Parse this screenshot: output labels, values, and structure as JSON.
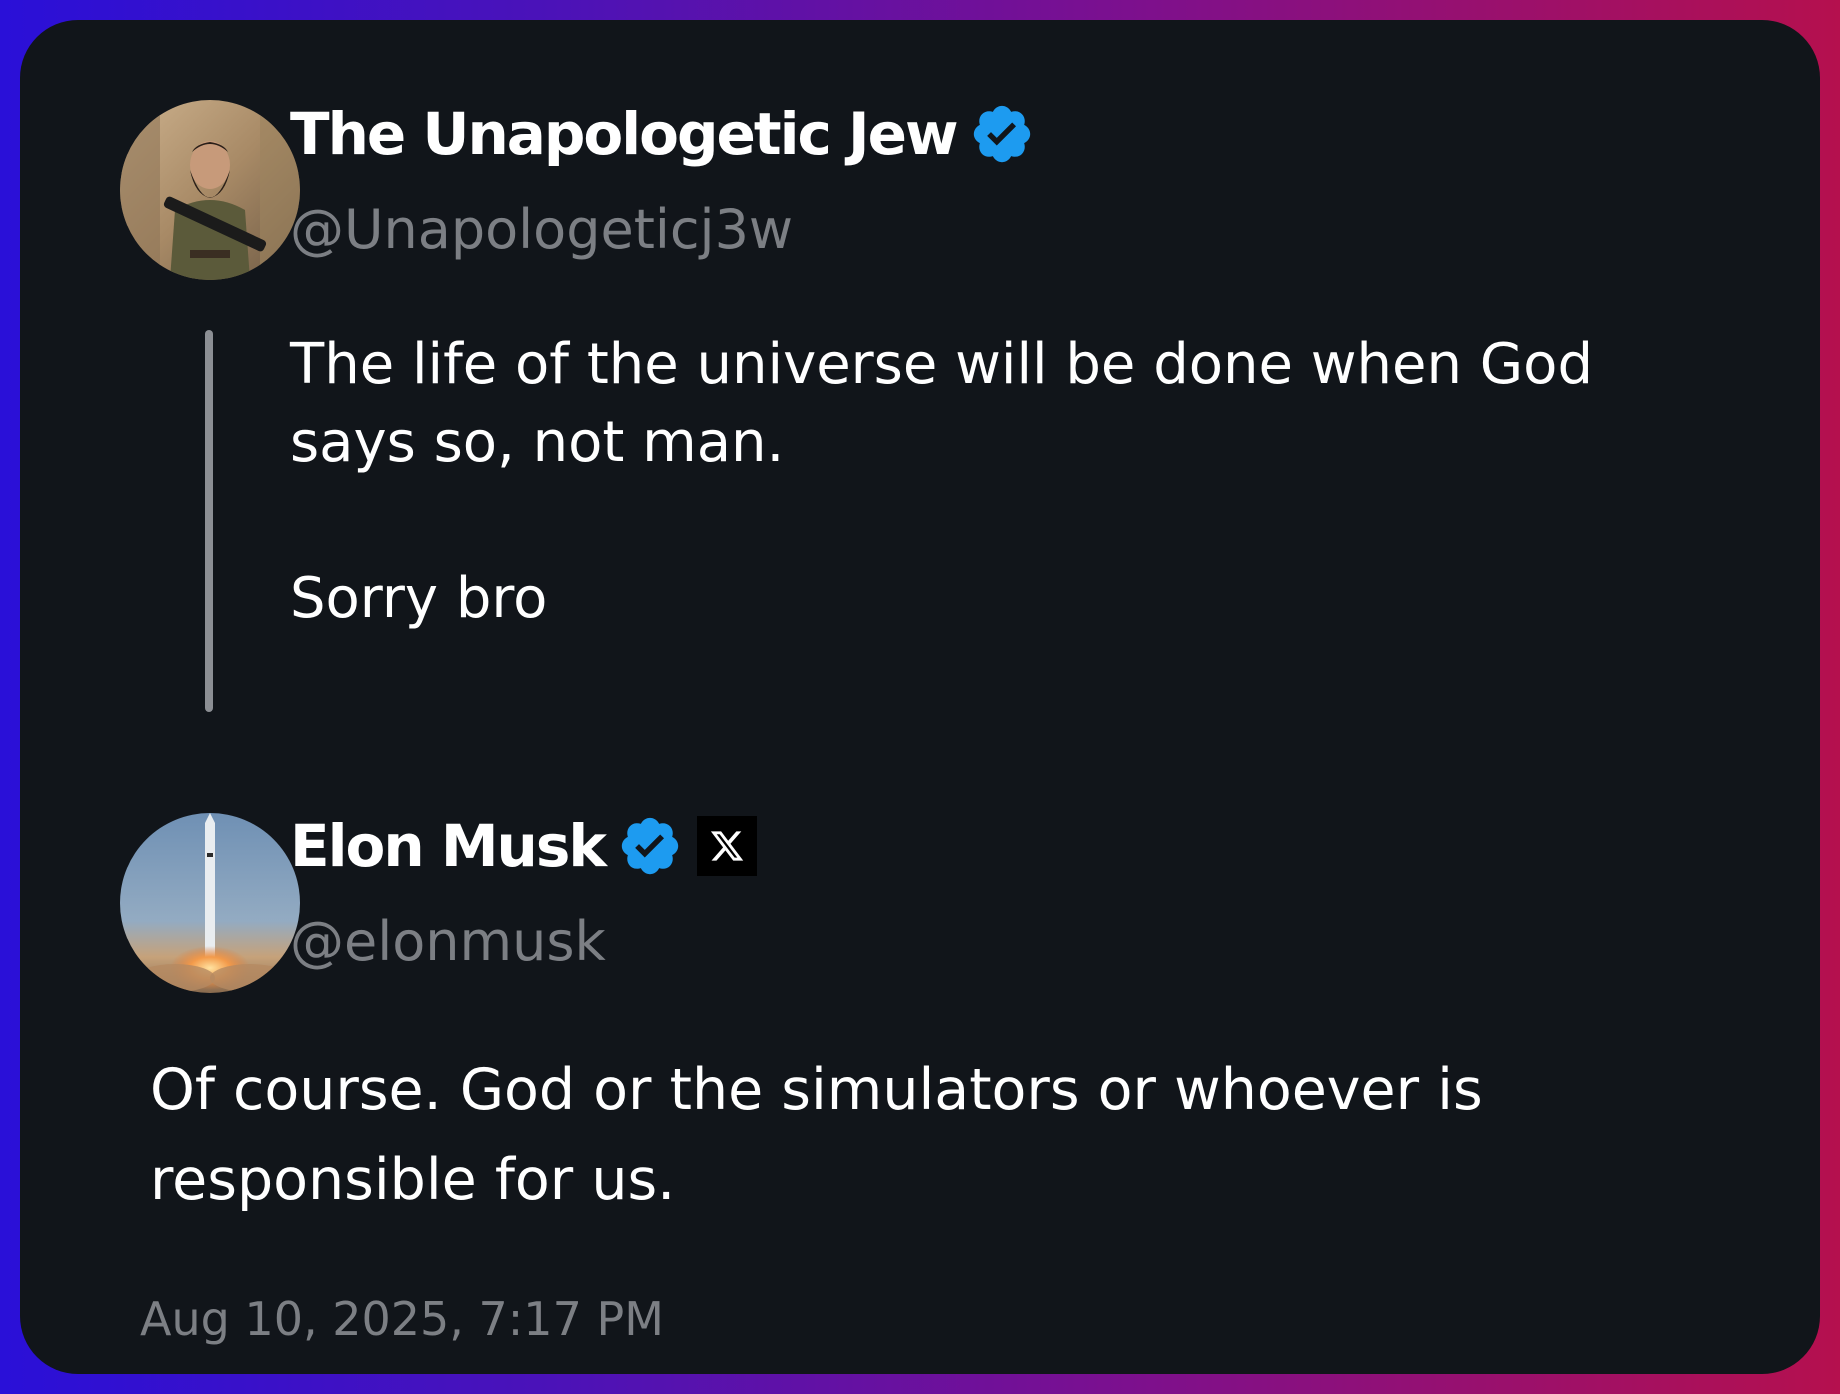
{
  "parent_tweet": {
    "author_name": "The Unapologetic Jew",
    "handle": "@Unapologeticj3w",
    "avatar_icon": "avatar-bearded-man-icon",
    "verified_icon": "verified-badge-icon",
    "text_line1": "The life of the universe will be done when God says so, not man.",
    "text_line2": "Sorry bro"
  },
  "reply_tweet": {
    "author_name": "Elon Musk",
    "handle": "@elonmusk",
    "avatar_icon": "avatar-rocket-launch-icon",
    "verified_icon": "verified-badge-icon",
    "affiliation_icon": "x-logo-icon",
    "text": "Of course. God or the simulators or whoever is responsible for us.",
    "timestamp": "Aug 10, 2025, 7:17 PM"
  },
  "colors": {
    "background_gradient_start": "#2a10d8",
    "background_gradient_end": "#b5104e",
    "card": "#11151a",
    "text_primary": "#ffffff",
    "text_secondary": "#7c7f84",
    "verified_blue": "#1d9bf0",
    "thread_line": "#8c8f94"
  }
}
